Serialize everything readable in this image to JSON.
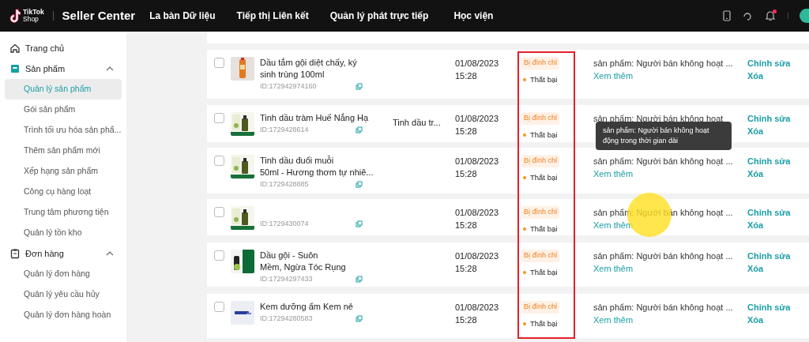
{
  "header": {
    "logo_text": [
      "TikTok",
      "Shop"
    ],
    "title": "Seller Center",
    "nav": [
      "La bàn Dữ liệu",
      "Tiếp thị Liên kết",
      "Quản lý phát trực tiếp",
      "Học viện"
    ],
    "notification_dot": true
  },
  "sidebar": {
    "groups": [
      {
        "label": "Trang chủ",
        "kind": "link"
      },
      {
        "label": "Sản phẩm",
        "kind": "group",
        "expanded": true,
        "items": [
          {
            "label": "Quản lý sản phẩm",
            "selected": true
          },
          {
            "label": "Gói sản phẩm",
            "selected": false
          },
          {
            "label": "Trình tối ưu hóa sản phẩ...",
            "selected": false
          },
          {
            "label": "Thêm sản phẩm mới",
            "selected": false
          },
          {
            "label": "Xếp hạng sản phẩm",
            "selected": false
          },
          {
            "label": "Công cụ hàng loạt",
            "selected": false
          },
          {
            "label": "Trung tâm phương tiện",
            "selected": false
          },
          {
            "label": "Quản lý tồn kho",
            "selected": false
          }
        ]
      },
      {
        "label": "Đơn hàng",
        "kind": "group",
        "expanded": true,
        "items": [
          {
            "label": "Quản lý đơn hàng",
            "selected": false
          },
          {
            "label": "Quản lý yêu cầu hủy",
            "selected": false
          },
          {
            "label": "Quản lý đơn hàng hoàn",
            "selected": false
          }
        ]
      }
    ]
  },
  "table": {
    "rows": [
      {
        "checked": false,
        "name_lines": [
          "Dầu tắm gội diệt chấy, ký",
          "sinh trùng 100ml"
        ],
        "id": "ID:172942974160",
        "date": "01/08/2023",
        "time": "15:28",
        "badge": "Bị đình chỉ",
        "status": "Thất bại",
        "reason": "sản phẩm: Người bán không hoạt ...",
        "more": "Xem thêm",
        "actions": [
          "Chỉnh sửa",
          "Xóa"
        ]
      },
      {
        "checked": false,
        "name_lines": [
          "Tinh dầu tràm Huế Nắng Hạ"
        ],
        "id": "ID:1729428614",
        "category": "Tinh dầu tr...",
        "date": "01/08/2023",
        "time": "15:28",
        "badge": "Bị đình chỉ",
        "status": "Thất bại",
        "reason": "sản phẩm: Người bán không hoạt",
        "actions": [
          "Chỉnh sửa",
          "Xóa"
        ]
      },
      {
        "checked": false,
        "name_lines": [
          "Tinh dầu đuổi muỗi",
          "50ml - Hương thơm tự nhiê..."
        ],
        "id": "ID:1729428885",
        "date": "01/08/2023",
        "time": "15:28",
        "badge": "Bị đình chỉ",
        "status": "Thất bại",
        "reason": "sản phẩm: Người bán không hoạt ...",
        "more": "Xem thêm",
        "actions": [
          "Chỉnh sửa",
          "Xóa"
        ]
      },
      {
        "checked": false,
        "name_lines": [],
        "id": "ID:1729430074",
        "date": "01/08/2023",
        "time": "15:28",
        "badge": "Bị đình chỉ",
        "status": "Thất bại",
        "reason": "sản phẩm: Người bán không hoạt ...",
        "more": "Xem thêm",
        "actions": [
          "Chỉnh sửa",
          "Xóa"
        ]
      },
      {
        "checked": false,
        "name_lines": [
          "Dầu gội - Suôn",
          "Mềm, Ngừa Tóc Rụng"
        ],
        "id": "ID:17294297433",
        "date": "01/08/2023",
        "time": "15:28",
        "badge": "Bị đình chỉ",
        "status": "Thất bại",
        "reason": "sản phẩm: Người bán không hoạt ...",
        "more": "Xem thêm",
        "actions": [
          "Chỉnh sửa",
          "Xóa"
        ]
      },
      {
        "checked": false,
        "name_lines": [
          "Kem dưỡng ẩm Kem nẻ"
        ],
        "id": "ID:17294280583",
        "date": "01/08/2023",
        "time": "15:28",
        "badge": "Bị đình chỉ",
        "status": "Thất bại",
        "reason": "sản phẩm: Người bán không hoạt ...",
        "more": "Xem thêm",
        "actions": [
          "Chỉnh sửa",
          "Xóa"
        ]
      }
    ]
  },
  "tooltip": {
    "lines": [
      "sản phẩm: Người bán không hoạt",
      "động trong thời gian dài"
    ]
  }
}
